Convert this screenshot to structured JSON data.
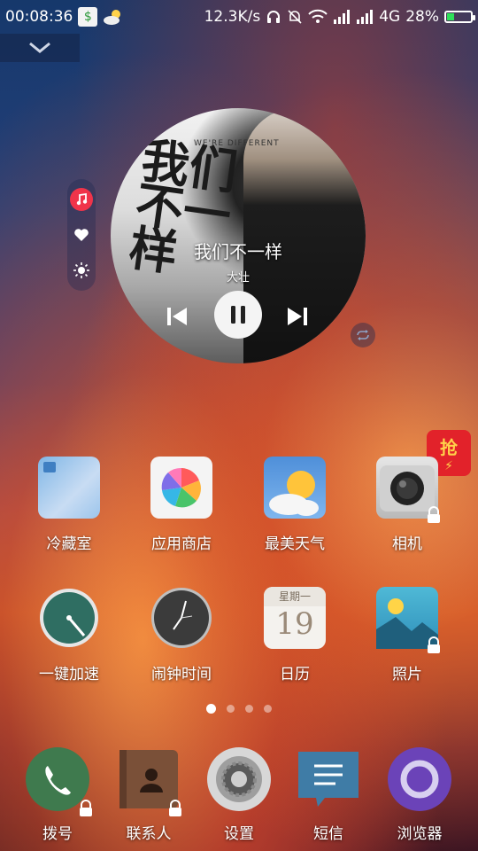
{
  "status_bar": {
    "time": "00:08:36",
    "net_speed": "12.3K/s",
    "network": "4G",
    "battery_percent": "28%",
    "battery_level": 0.28,
    "icons": [
      "app-notification-icon",
      "weather-icon",
      "headset-icon",
      "mute-bell-icon",
      "wifi-icon",
      "signal-icon",
      "signal-icon-2",
      "battery-icon"
    ]
  },
  "music_widget": {
    "song_title": "我们不一样",
    "artist": "大壮",
    "album_art_text": "我们不一样",
    "album_art_subtext": "WE'RE DIFFERENT",
    "side_icons": [
      "music-icon",
      "heart-icon",
      "brightness-icon"
    ]
  },
  "apps": [
    {
      "label": "冷藏室",
      "icon": "freezer-icon",
      "locked": false
    },
    {
      "label": "应用商店",
      "icon": "app-store-icon",
      "locked": false
    },
    {
      "label": "最美天气",
      "icon": "weather-app-icon",
      "locked": false
    },
    {
      "label": "相机",
      "icon": "camera-icon",
      "locked": true
    },
    {
      "label": "一键加速",
      "icon": "speed-up-icon",
      "locked": false
    },
    {
      "label": "闹钟时间",
      "icon": "clock-icon",
      "locked": false
    },
    {
      "label": "日历",
      "icon": "calendar-icon",
      "locked": false
    },
    {
      "label": "照片",
      "icon": "photos-icon",
      "locked": true
    }
  ],
  "calendar": {
    "weekday": "星期一",
    "day": "19"
  },
  "hongbao": {
    "label": "抢"
  },
  "page_indicator": {
    "pages": 4,
    "active": 0
  },
  "dock": [
    {
      "label": "拨号",
      "icon": "phone-icon",
      "locked": true
    },
    {
      "label": "联系人",
      "icon": "contacts-icon",
      "locked": true
    },
    {
      "label": "设置",
      "icon": "settings-icon",
      "locked": false
    },
    {
      "label": "短信",
      "icon": "messages-icon",
      "locked": false
    },
    {
      "label": "浏览器",
      "icon": "browser-icon",
      "locked": false
    }
  ],
  "colors": {
    "music_red": "#f0344a",
    "battery_green": "#2fe05a",
    "hongbao_red": "#e2222a"
  }
}
